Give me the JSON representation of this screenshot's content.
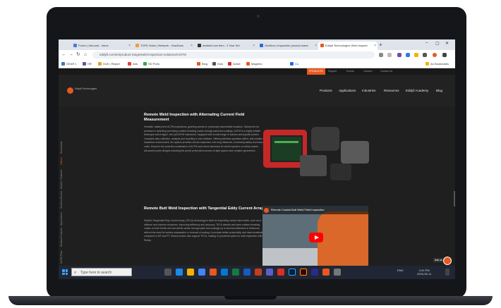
{
  "browser": {
    "tabs": [
      {
        "label": "Forum | Inbound - Inbox",
        "active": false
      },
      {
        "label": "TOFD Video | Network - HowDoes",
        "active": false
      },
      {
        "label": "adafruit.com item - 2 Year Sel",
        "active": false
      },
      {
        "label": "Oerlikon | Inspection product wand",
        "active": false
      },
      {
        "label": "Eddyfi Technologies Weld Inspect",
        "active": true
      }
    ],
    "new_tab_label": "+",
    "url": "eddyfi.com/en/product-range/weld-inspection-solutions/ACFM",
    "bookmarks": [
      "GEAR 1",
      "HR",
      "DUK | Report",
      "Ads",
      "SD Ports",
      "Blog",
      "Dolo",
      "Active",
      "Magento",
      "Co",
      "An Bookmarks"
    ]
  },
  "site": {
    "utility_nav": [
      "PRODUCTS",
      "Support",
      "Events",
      "Careers",
      "Contact Us"
    ],
    "utility_highlight": "PRODUCTS",
    "logo_text": "Eddyfi Technologies",
    "main_nav": [
      "Products",
      "Applications",
      "Industries",
      "Resources",
      "Eddyfi Academy",
      "Blog"
    ],
    "sidebar_links": [
      "ACFM Flaw",
      "Related Products",
      "Applications",
      "Solution Review",
      "Details / Features",
      "Videos",
      "Downloads"
    ],
    "section1": {
      "title": "Remote Weld Inspection with Alternating Current Field Measurement",
      "body": "Versatile, battery-free ACFM inspections, granting access to previously inaccessible locations. Tailored for its precision in detecting and sizing surface-breaking cracks through paint and coatings, ACFM is a highly reliable technique with Amigo2, the Lyft ACFM instrument, equipped with a wide range of subsea and topside probes. Complete data collection, analysis and reporting in one software. Offering wireless operation within, and outside of, a hazardous environment, the system provides remote inspection over long distances, enhancing safety and reducing costs. Discover the powerful combination of ACFM and robust hardware for weld inspection of critical assets. Advanced probe designs including the pencil probe allow access to tight spaces and complex geometries.",
      "link_words": [
        "Amigo2"
      ]
    },
    "section2": {
      "title": "Remote Butt Weld Inspection with Tangential Eddy Current Array",
      "body": "Eddyfi's Tangential Eddy Current Array (TECA) technology is ideal for inspecting carbon steel welds, such as in offshore and onshore structures, improving efficiency and accuracy. TECA detects and sizes surface-breaking cracks on both ferritic and non-ferritic welds, through paint and coatings up to several millimeters in thickness, without the need for surface preparation or removal of coating. It provides better productivity, and data visualization compared to MT and PT. Sharck probes also support TECA, making it a powerful option for weld inspection with Reddy.",
      "link_words": [
        "TECA"
      ]
    },
    "video": {
      "title": "Remote Coated Butt Weld Field Inspection",
      "watch_label": "Watch on YouTube",
      "channel_icon": "eddyfi-channel-icon"
    },
    "chat_label": "Ask us"
  },
  "taskbar": {
    "search_placeholder": "Type here to search",
    "time": "4:41 PM",
    "date": "2023-05-11",
    "tray_lang": "ENG"
  },
  "colors": {
    "accent": "#e8581f",
    "page_bg": "#1f1f1f",
    "taskbar": "#202634"
  }
}
